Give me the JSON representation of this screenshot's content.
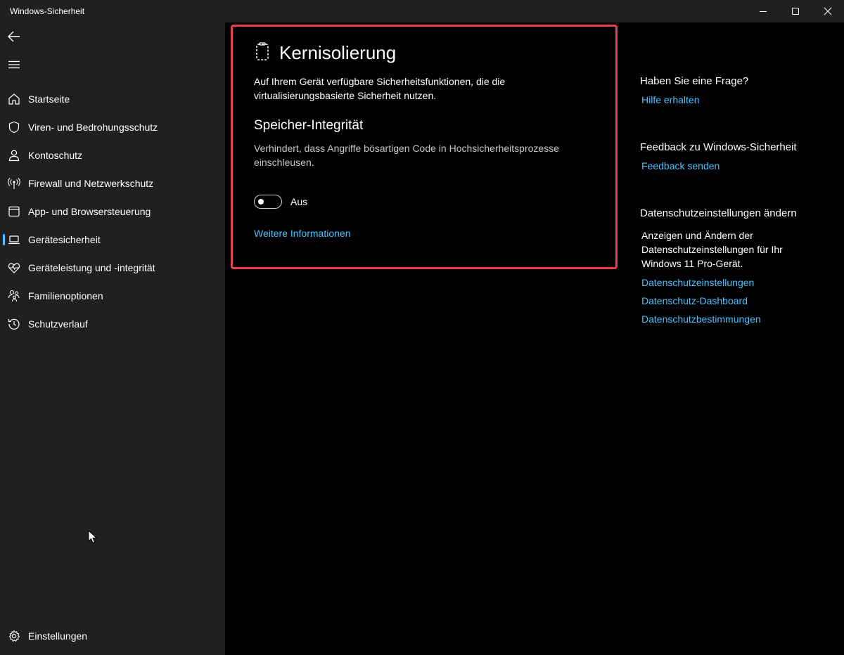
{
  "window": {
    "title": "Windows-Sicherheit"
  },
  "sidebar": {
    "items": [
      {
        "label": "Startseite",
        "icon": "home-icon"
      },
      {
        "label": "Viren- und Bedrohungsschutz",
        "icon": "shield-icon"
      },
      {
        "label": "Kontoschutz",
        "icon": "person-icon"
      },
      {
        "label": "Firewall und Netzwerkschutz",
        "icon": "antenna-icon"
      },
      {
        "label": "App- und Browsersteuerung",
        "icon": "browser-window-icon"
      },
      {
        "label": "Gerätesicherheit",
        "icon": "laptop-icon",
        "active": true
      },
      {
        "label": "Geräteleistung und -integrität",
        "icon": "heart-pulse-icon"
      },
      {
        "label": "Familienoptionen",
        "icon": "family-icon"
      },
      {
        "label": "Schutzverlauf",
        "icon": "history-icon"
      }
    ],
    "settings_label": "Einstellungen"
  },
  "main": {
    "title": "Kernisolierung",
    "description": "Auf Ihrem Gerät verfügbare Sicherheitsfunktionen, die die virtualisierungsbasierte Sicherheit nutzen.",
    "section": {
      "title": "Speicher-Integrität",
      "description": "Verhindert, dass Angriffe bösartigen Code in Hochsicherheitsprozesse einschleusen.",
      "toggle_state": "Aus",
      "toggle_on": false
    },
    "more_link": "Weitere Informationen"
  },
  "right": {
    "question_heading": "Haben Sie eine Frage?",
    "help_link": "Hilfe erhalten",
    "feedback_heading": "Feedback zu Windows-Sicherheit",
    "feedback_link": "Feedback senden",
    "privacy_heading": "Datenschutzeinstellungen ändern",
    "privacy_text": "Anzeigen und Ändern der Datenschutzeinstellungen für Ihr Windows 11 Pro-Gerät.",
    "privacy_links": [
      "Datenschutzeinstellungen",
      "Datenschutz-Dashboard",
      "Datenschutzbestimmungen"
    ]
  },
  "colors": {
    "accent": "#4cc2ff",
    "highlight_border": "#e8414a",
    "sidebar_bg": "#202020",
    "content_bg": "#000000"
  }
}
